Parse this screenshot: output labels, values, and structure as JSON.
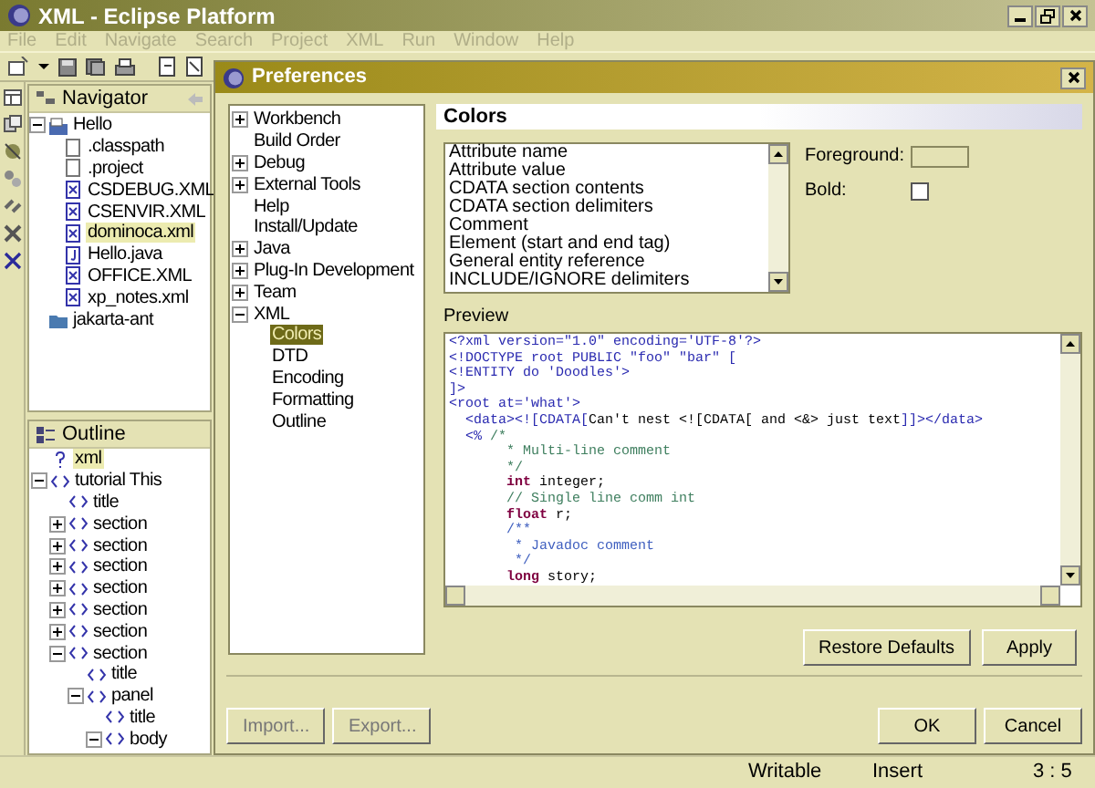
{
  "window": {
    "title": "XML - Eclipse Platform"
  },
  "menu": [
    "File",
    "Edit",
    "Navigate",
    "Search",
    "Project",
    "XML",
    "Run",
    "Window",
    "Help"
  ],
  "navigator": {
    "title": "Navigator",
    "items": [
      {
        "label": "Hello",
        "kind": "project",
        "expanded": true,
        "selected": false,
        "children": [
          {
            "label": ".classpath",
            "kind": "file",
            "selected": false
          },
          {
            "label": ".project",
            "kind": "file",
            "selected": false
          },
          {
            "label": "CSDEBUG.XML",
            "kind": "xml",
            "selected": false
          },
          {
            "label": "CSENVIR.XML",
            "kind": "xml",
            "selected": false
          },
          {
            "label": "dominoca.xml",
            "kind": "xml",
            "selected": true
          },
          {
            "label": "Hello.java",
            "kind": "java",
            "selected": false
          },
          {
            "label": "OFFICE.XML",
            "kind": "xml",
            "selected": false
          },
          {
            "label": "xp_notes.xml",
            "kind": "xml",
            "selected": false
          }
        ]
      },
      {
        "label": "jakarta-ant",
        "kind": "folder",
        "selected": false
      }
    ]
  },
  "outline": {
    "title": "Outline",
    "items": [
      {
        "label": "xml",
        "kind": "pi",
        "selected": true
      },
      {
        "label": "tutorial This",
        "kind": "element",
        "expanded": true,
        "selected": false,
        "children": [
          {
            "label": "title",
            "kind": "element",
            "selected": false
          },
          {
            "label": "section",
            "kind": "element",
            "expanded": false,
            "selected": false
          },
          {
            "label": "section",
            "kind": "element",
            "expanded": false,
            "selected": false
          },
          {
            "label": "section",
            "kind": "element",
            "expanded": false,
            "selected": false
          },
          {
            "label": "section",
            "kind": "element",
            "expanded": false,
            "selected": false
          },
          {
            "label": "section",
            "kind": "element",
            "expanded": false,
            "selected": false
          },
          {
            "label": "section",
            "kind": "element",
            "expanded": false,
            "selected": false
          },
          {
            "label": "section",
            "kind": "element",
            "expanded": true,
            "selected": false,
            "children": [
              {
                "label": "title",
                "kind": "element",
                "selected": false
              },
              {
                "label": "panel",
                "kind": "element",
                "expanded": true,
                "selected": false,
                "children": [
                  {
                    "label": "title",
                    "kind": "element",
                    "selected": false
                  },
                  {
                    "label": "body",
                    "kind": "element",
                    "expanded": true,
                    "selected": false
                  }
                ]
              }
            ]
          }
        ]
      }
    ]
  },
  "dialog": {
    "title": "Preferences",
    "tree": [
      {
        "label": "Workbench",
        "expanded": false,
        "selected": false
      },
      {
        "label": "Build Order",
        "selected": false
      },
      {
        "label": "Debug",
        "expanded": false,
        "selected": false
      },
      {
        "label": "External Tools",
        "expanded": false,
        "selected": false
      },
      {
        "label": "Help",
        "selected": false
      },
      {
        "label": "Install/Update",
        "selected": false
      },
      {
        "label": "Java",
        "expanded": false,
        "selected": false
      },
      {
        "label": "Plug-In Development",
        "expanded": false,
        "selected": false
      },
      {
        "label": "Team",
        "expanded": false,
        "selected": false
      },
      {
        "label": "XML",
        "expanded": true,
        "selected": false,
        "children": [
          {
            "label": "Colors",
            "selected": true
          },
          {
            "label": "DTD",
            "selected": false
          },
          {
            "label": "Encoding",
            "selected": false
          },
          {
            "label": "Formatting",
            "selected": false
          },
          {
            "label": "Outline",
            "selected": false
          }
        ]
      }
    ],
    "page_title": "Colors",
    "color_items": [
      "Attribute name",
      "Attribute value",
      "CDATA section contents",
      "CDATA section delimiters",
      "Comment",
      "Element (start and end tag)",
      "General entity reference",
      "INCLUDE/IGNORE delimiters"
    ],
    "foreground_label": "Foreground:",
    "bold_label": "Bold:",
    "bold_checked": false,
    "preview_label": "Preview",
    "preview": [
      [
        {
          "kind": "tag",
          "text": "<?xml version=\"1.0\" encoding='UTF-8'?>"
        }
      ],
      [
        {
          "kind": "tag",
          "text": "<!DOCTYPE root PUBLIC \"foo\" \"bar\" ["
        }
      ],
      [
        {
          "kind": "tag",
          "text": "<!ENTITY do 'Doodles'>"
        }
      ],
      [
        {
          "kind": "tag",
          "text": "]>"
        }
      ],
      [
        {
          "kind": "tag",
          "text": "<root at='what'>"
        }
      ],
      [
        {
          "kind": "tag",
          "text": "  <data><![CDATA["
        },
        {
          "kind": "plain",
          "text": "Can't nest <![CDATA[ and <&> just text"
        },
        {
          "kind": "tag",
          "text": "]]></data>"
        }
      ],
      [
        {
          "kind": "tag",
          "text": "  <%"
        },
        {
          "kind": "comment",
          "text": " /*"
        }
      ],
      [
        {
          "kind": "comment",
          "text": "       * Multi-line comment"
        }
      ],
      [
        {
          "kind": "comment",
          "text": "       */"
        }
      ],
      [
        {
          "kind": "keyword",
          "text": "       int"
        },
        {
          "kind": "plain",
          "text": " integer;"
        }
      ],
      [
        {
          "kind": "comment",
          "text": "       // Single line comm int"
        }
      ],
      [
        {
          "kind": "keyword",
          "text": "       float"
        },
        {
          "kind": "plain",
          "text": " r;"
        }
      ],
      [
        {
          "kind": "doc",
          "text": "       /**"
        }
      ],
      [
        {
          "kind": "doc",
          "text": "        * Javadoc comment"
        }
      ],
      [
        {
          "kind": "doc",
          "text": "        */"
        }
      ],
      [
        {
          "kind": "keyword",
          "text": "       long"
        },
        {
          "kind": "plain",
          "text": " story;"
        }
      ]
    ],
    "buttons": [
      "Restore Defaults",
      "Apply"
    ],
    "bottom_buttons": [
      "Import...",
      "Export..."
    ],
    "ok_cancel": [
      "OK",
      "Cancel"
    ]
  },
  "status_bar": [
    "Writable",
    "Insert",
    "3 : 5"
  ]
}
